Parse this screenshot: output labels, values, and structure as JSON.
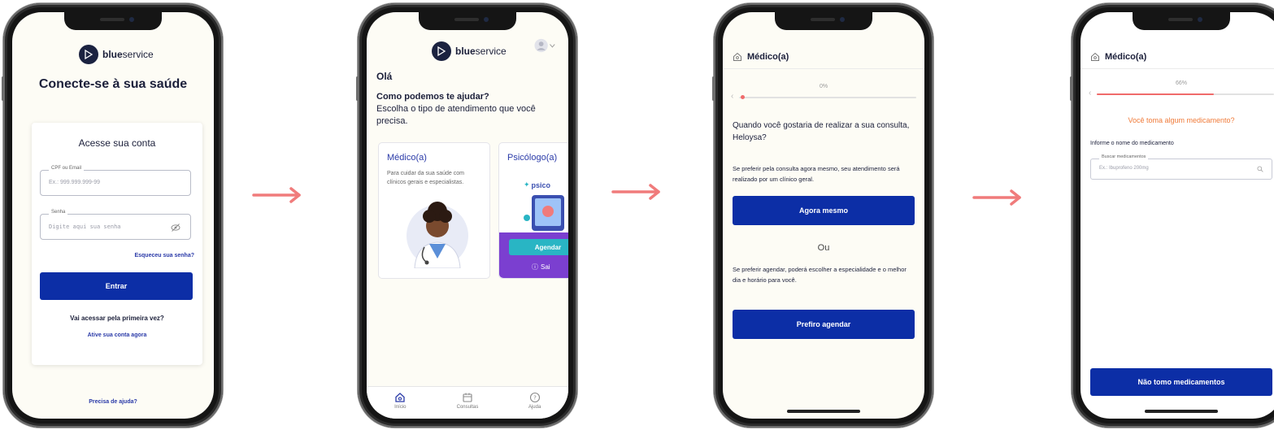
{
  "colors": {
    "primary": "#0c2ea6",
    "link": "#2a3aa8",
    "accent_orange": "#f07b3a",
    "progress": "#f06b6b",
    "arrow": "#f07b7b"
  },
  "brand": {
    "logo_bold": "blue",
    "logo_regular": "service"
  },
  "screen1": {
    "title": "Conecte-se à sua saúde",
    "card_title": "Acesse sua conta",
    "cpf_label": "CPF ou Email",
    "cpf_placeholder": "Ex.: 999.999.999-99",
    "password_label": "Senha",
    "password_placeholder": "Digite aqui sua senha",
    "forgot": "Esqueceu sua senha?",
    "login_button": "Entrar",
    "first_time": "Vai acessar pela primeira vez?",
    "activate": "Ative sua conta agora",
    "help": "Precisa de ajuda?"
  },
  "screen2": {
    "greeting": "Olá",
    "question": "Como podemos te ajudar?",
    "subtitle": "Escolha o tipo de atendimento que você precisa.",
    "card_medico_title": "Médico(a)",
    "card_medico_desc": "Para cuidar da sua saúde com clínicos gerais e especialistas.",
    "card_psico_title": "Psicólogo(a)",
    "card_psico_brand": "psico",
    "card_psico_button": "Agendar",
    "card_psico_footer": "Sai",
    "tabs": [
      {
        "label": "Início",
        "icon": "home-icon"
      },
      {
        "label": "Consultas",
        "icon": "calendar-icon"
      },
      {
        "label": "Ajuda",
        "icon": "help-icon"
      }
    ]
  },
  "screen3": {
    "header_title": "Médico(a)",
    "progress_label": "0%",
    "progress_value": 0,
    "question": "Quando você gostaria de realizar a sua consulta, Heloysa?",
    "now_text": "Se preferir pela consulta agora mesmo, seu atendimento será realizado por um clínico geral.",
    "now_button": "Agora mesmo",
    "or": "Ou",
    "schedule_text": "Se preferir agendar, poderá escolher a especialidade e o melhor dia e horário para você.",
    "schedule_button": "Prefiro agendar"
  },
  "screen4": {
    "header_title": "Médico(a)",
    "progress_label": "66%",
    "progress_value": 0.66,
    "question": "Você toma algum medicamento?",
    "field_label": "Informe o nome do medicamento",
    "search_label": "Buscar medicamentos",
    "search_placeholder": "Ex.: Ibuprofeno 200mg",
    "no_meds_button": "Não tomo medicamentos"
  }
}
